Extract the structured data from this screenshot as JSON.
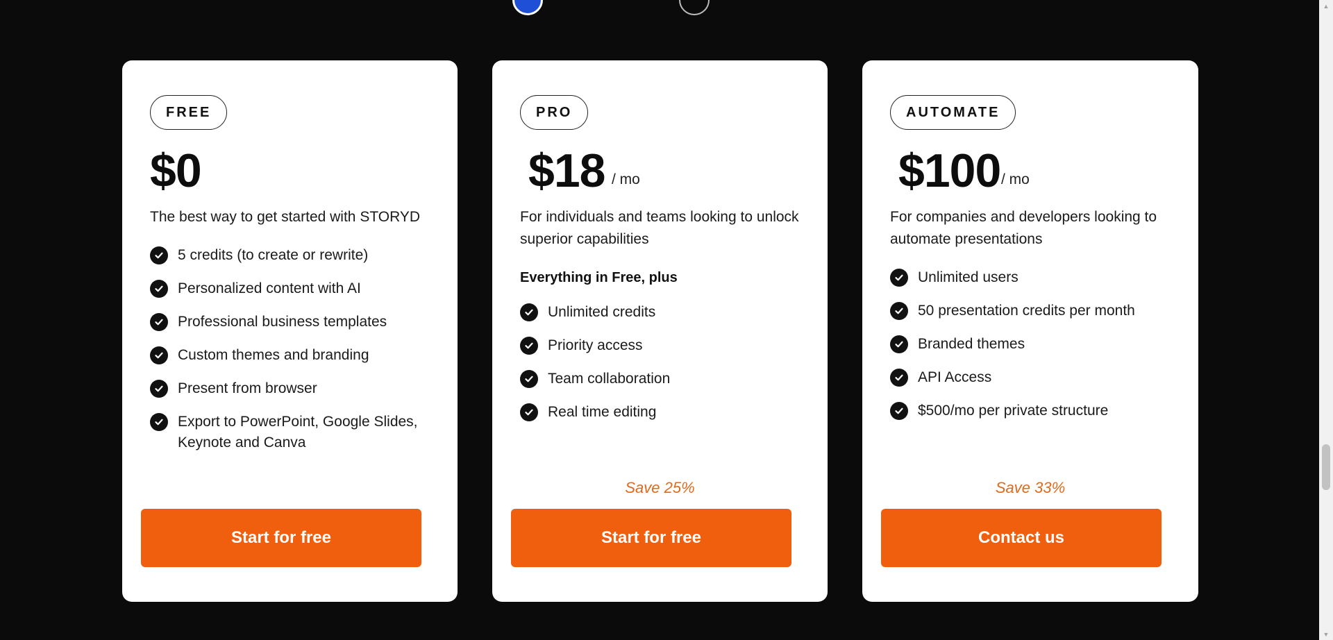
{
  "plans": [
    {
      "tier": "FREE",
      "price": "$0",
      "per": "",
      "description": "The best way to get started with STORYD",
      "subhead": "",
      "features": [
        "5 credits (to create or rewrite)",
        "Personalized content with AI",
        "Professional business templates",
        "Custom themes and branding",
        "Present from browser",
        "Export to PowerPoint, Google Slides, Keynote and Canva"
      ],
      "save": "",
      "cta": "Start for free"
    },
    {
      "tier": "PRO",
      "price": "$18",
      "per": "/ mo",
      "description": "For individuals and teams looking to unlock superior  capabilities",
      "subhead": "Everything in Free, plus",
      "features": [
        "Unlimited credits",
        "Priority access",
        "Team collaboration",
        "Real time editing"
      ],
      "save": "Save 25%",
      "cta": "Start for free"
    },
    {
      "tier": "AUTOMATE",
      "price": "$100",
      "per": "/ mo",
      "description": "For companies and developers looking to automate presentations",
      "subhead": "",
      "features": [
        "Unlimited users",
        "50 presentation credits per month",
        "Branded themes",
        "API Access",
        "$500/mo per private structure"
      ],
      "save": "Save 33%",
      "cta": "Contact us"
    }
  ],
  "icons": {
    "feature": "check-circle-icon",
    "scroll_up": "scroll-up-arrow",
    "scroll_down": "scroll-down-arrow"
  },
  "colors": {
    "page_background": "#0b0b0b",
    "card_background": "#ffffff",
    "cta_background": "#f05f0e",
    "save_text": "#e06a1b",
    "active_toggle": "#1f4fd6"
  }
}
